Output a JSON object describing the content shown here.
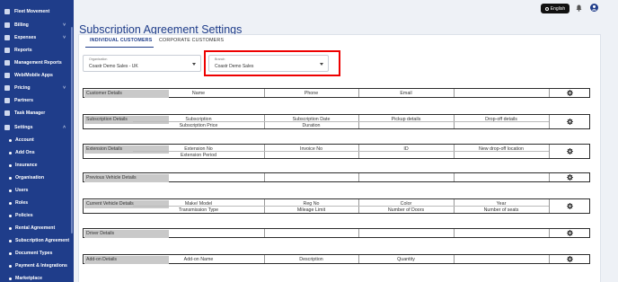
{
  "sidebar": {
    "items": [
      {
        "label": "Fleet Movement",
        "chevron": false,
        "sub": false
      },
      {
        "label": "Billing",
        "chevron": true,
        "sub": false
      },
      {
        "label": "Expenses",
        "chevron": true,
        "sub": false
      },
      {
        "label": "Reports",
        "chevron": false,
        "sub": false
      },
      {
        "label": "Management Reports",
        "chevron": false,
        "sub": false
      },
      {
        "label": "Web/Mobile Apps",
        "chevron": false,
        "sub": false
      },
      {
        "label": "Pricing",
        "chevron": true,
        "sub": false
      },
      {
        "label": "Partners",
        "chevron": false,
        "sub": false
      },
      {
        "label": "Task Manager",
        "chevron": false,
        "sub": false
      },
      {
        "label": "Settings",
        "chevron": true,
        "sub": false
      },
      {
        "label": "Account",
        "chevron": false,
        "sub": true
      },
      {
        "label": "Add Ons",
        "chevron": false,
        "sub": true
      },
      {
        "label": "Insurance",
        "chevron": false,
        "sub": true
      },
      {
        "label": "Organisation",
        "chevron": false,
        "sub": true
      },
      {
        "label": "Users",
        "chevron": false,
        "sub": true
      },
      {
        "label": "Roles",
        "chevron": false,
        "sub": true
      },
      {
        "label": "Policies",
        "chevron": false,
        "sub": true
      },
      {
        "label": "Rental Agreement",
        "chevron": false,
        "sub": true
      },
      {
        "label": "Subscription Agreement",
        "chevron": false,
        "sub": true
      },
      {
        "label": "Document Types",
        "chevron": false,
        "sub": true
      },
      {
        "label": "Payment & Integrations",
        "chevron": false,
        "sub": true
      },
      {
        "label": "Marketplace",
        "chevron": false,
        "sub": true
      }
    ]
  },
  "header": {
    "language": "English",
    "page_title": "Subscription Agreement Settings"
  },
  "tabs": [
    "INDIVIDUAL CUSTOMERS",
    "CORPORATE CUSTOMERS"
  ],
  "filters": {
    "organisation_label": "Organisation",
    "organisation_value": "Coastr Demo Sales - UK",
    "branch_label": "Branch",
    "branch_value": "Coastr Demo Sales"
  },
  "sections": [
    {
      "title": "Customer Details",
      "row1": [
        "Name",
        "Phone",
        "Email",
        ""
      ],
      "row2": []
    },
    {
      "title": "Subscription Details",
      "row1": [
        "Subscription",
        "Subscription Date",
        "Pickup details",
        "Drop-off details"
      ],
      "row2": [
        "Subscription Price",
        "Duration",
        "",
        ""
      ]
    },
    {
      "title": "Extension Details",
      "row1": [
        "Extension No",
        "Invoice No",
        "ID",
        "New drop-off location"
      ],
      "row2": [
        "Extension Period",
        "",
        "",
        ""
      ]
    },
    {
      "title": "Previous Vehicle Details",
      "row1": [
        "",
        "",
        "",
        ""
      ],
      "row2": []
    },
    {
      "title": "Current Vehicle Details",
      "row1": [
        "Make/ Model",
        "Reg No",
        "Color",
        "Year"
      ],
      "row2": [
        "Transmission Type",
        "Mileage Limit",
        "Number of Doors",
        "Number of seats"
      ]
    },
    {
      "title": "Driver Details",
      "row1": [
        "",
        "",
        "",
        ""
      ],
      "row2": []
    },
    {
      "title": "Add-on Details",
      "row1": [
        "Add-on Name",
        "Description",
        "Quantity",
        ""
      ],
      "row2": []
    }
  ],
  "colors": {
    "sidebar": "#1f3d8a",
    "title": "#1f3d8a",
    "highlight": "#e00000"
  }
}
